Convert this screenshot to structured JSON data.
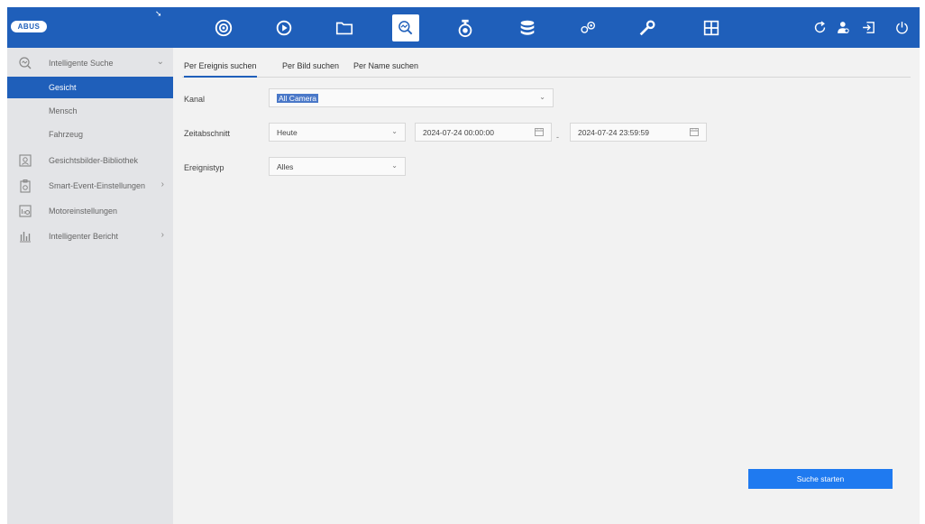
{
  "brand": {
    "logo_text": "ABUS"
  },
  "colors": {
    "primary": "#1f5fba",
    "sidebar_bg": "#e3e4e7",
    "content_bg": "#f2f2f2",
    "button": "#1f7af0"
  },
  "toolbar": {
    "nav_icons": [
      "camera-icon",
      "playback-icon",
      "folder-icon",
      "smart-search-icon",
      "ptz-camera-icon",
      "storage-icon",
      "settings-icon",
      "maintenance-icon",
      "layout-icon"
    ],
    "active": "smart-search-icon",
    "right_icons": [
      "refresh-icon",
      "user-icon",
      "logout-icon",
      "power-icon"
    ]
  },
  "sidebar": {
    "items": [
      {
        "label": "Intelligente Suche",
        "icon": "smart-search-icon",
        "has_chevron": true,
        "chevron": "⌄"
      },
      {
        "label": "Gesichtsbilder-Bibliothek",
        "icon": "face-library-icon"
      },
      {
        "label": "Smart-Event-Einstellungen",
        "icon": "smart-event-icon",
        "has_chevron": true,
        "chevron": "›"
      },
      {
        "label": "Motoreinstellungen",
        "icon": "motor-icon"
      },
      {
        "label": "Intelligenter Bericht",
        "icon": "report-icon",
        "has_chevron": true,
        "chevron": "›"
      }
    ],
    "sub_items": [
      "Gesicht",
      "Mensch",
      "Fahrzeug"
    ],
    "selected_sub": "Gesicht"
  },
  "tabs": [
    "Per Ereignis suchen",
    "Per Bild suchen",
    "Per Name suchen"
  ],
  "active_tab": "Per Ereignis suchen",
  "form": {
    "kanal": {
      "label": "Kanal",
      "value": "All Camera"
    },
    "zeitabschnitt": {
      "label": "Zeitabschnitt",
      "value": "Heute",
      "start": "2024-07-24 00:00:00",
      "end": "2024-07-24 23:59:59",
      "separator": "-"
    },
    "ereignistyp": {
      "label": "Ereignistyp",
      "value": "Alles"
    },
    "caret": "⌄"
  },
  "actions": {
    "start_search": "Suche starten"
  }
}
